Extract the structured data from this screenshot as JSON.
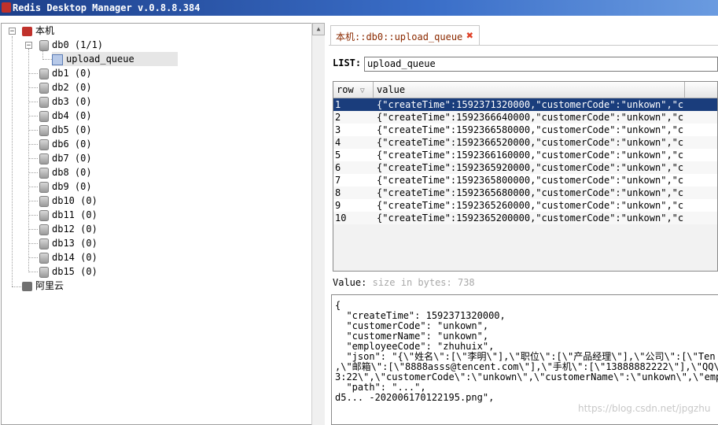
{
  "window": {
    "title": "Redis Desktop Manager v.0.8.8.384"
  },
  "tree": {
    "server_label": "本机",
    "db0_label": "db0  (1/1)",
    "key_label": "upload_queue",
    "dbs": [
      "db1  (0)",
      "db2  (0)",
      "db3  (0)",
      "db4  (0)",
      "db5  (0)",
      "db6  (0)",
      "db7  (0)",
      "db8  (0)",
      "db9  (0)",
      "db10 (0)",
      "db11 (0)",
      "db12 (0)",
      "db13 (0)",
      "db14 (0)",
      "db15 (0)"
    ],
    "cloud_label": "阿里云"
  },
  "tab": {
    "label": "本机::db0::upload_queue",
    "close_icon": "close-icon"
  },
  "list": {
    "label": "LIST:",
    "value": "upload_queue"
  },
  "table": {
    "headers": [
      "row",
      "value"
    ],
    "rows": [
      {
        "row": "1",
        "value": "{\"createTime\":1592371320000,\"customerCode\":\"unkown\",\"c⋯"
      },
      {
        "row": "2",
        "value": "{\"createTime\":1592366640000,\"customerCode\":\"unkown\",\"c⋯"
      },
      {
        "row": "3",
        "value": "{\"createTime\":1592366580000,\"customerCode\":\"unkown\",\"c⋯"
      },
      {
        "row": "4",
        "value": "{\"createTime\":1592366520000,\"customerCode\":\"unkown\",\"c⋯"
      },
      {
        "row": "5",
        "value": "{\"createTime\":1592366160000,\"customerCode\":\"unkown\",\"c⋯"
      },
      {
        "row": "6",
        "value": "{\"createTime\":1592365920000,\"customerCode\":\"unkown\",\"c⋯"
      },
      {
        "row": "7",
        "value": "{\"createTime\":1592365800000,\"customerCode\":\"unkown\",\"c⋯"
      },
      {
        "row": "8",
        "value": "{\"createTime\":1592365680000,\"customerCode\":\"unkown\",\"c⋯"
      },
      {
        "row": "9",
        "value": "{\"createTime\":1592365260000,\"customerCode\":\"unkown\",\"c⋯"
      },
      {
        "row": "10",
        "value": "{\"createTime\":1592365200000,\"customerCode\":\"unkown\",\"c⋯"
      }
    ],
    "selected_row": "1"
  },
  "value_panel": {
    "label": "Value:",
    "size_hint": "size in bytes: 738",
    "lines": [
      "{",
      "  \"createTime\": 1592371320000,",
      "  \"customerCode\": \"unkown\",",
      "  \"customerName\": \"unkown\",",
      "  \"employeeCode\": \"zhuhuix\",",
      "  \"json\": \"{\\\"姓名\\\":[\\\"李明\\\"],\\\"职位\\\":[\\\"产品经理\\\"],\\\"公司\\\":[\\\"Ten",
      ",\\\"邮箱\\\":[\\\"8888asss@tencent.com\\\"],\\\"手机\\\":[\\\"13888882222\\\"],\\\"QQ\\\"",
      "3:22\\\",\\\"customerCode\\\":\\\"unkown\\\",\\\"customerName\\\":\\\"unkown\\\",\\\"emplo",
      "  \"path\": \"...\",",
      "d5... -202006170122195.png\","
    ]
  },
  "watermark": "https://blog.csdn.net/jpgzhu"
}
